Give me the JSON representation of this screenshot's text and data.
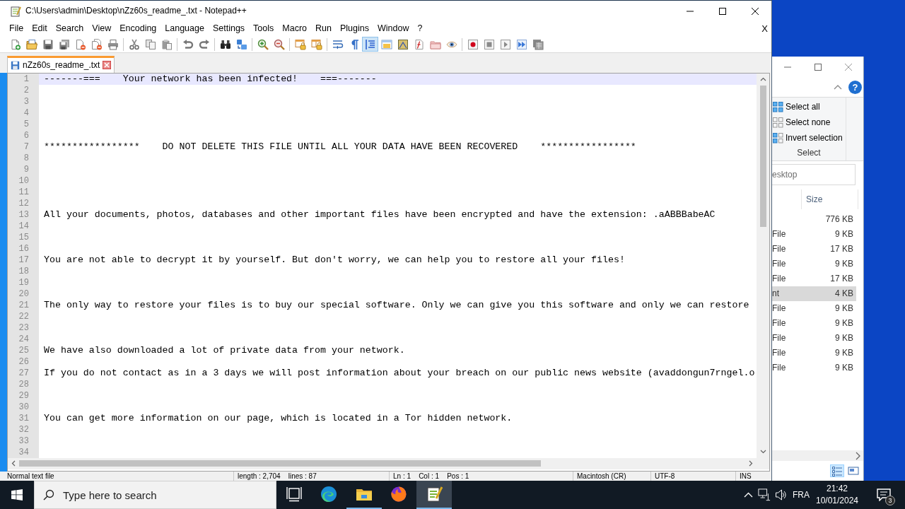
{
  "notepad": {
    "title": "C:\\Users\\admin\\Desktop\\nZz60s_readme_.txt - Notepad++",
    "menu": [
      "File",
      "Edit",
      "Search",
      "View",
      "Encoding",
      "Language",
      "Settings",
      "Tools",
      "Macro",
      "Run",
      "Plugins",
      "Window",
      "?"
    ],
    "close_document": "X",
    "toolbar": [
      {
        "kind": "new",
        "pressed": false
      },
      {
        "kind": "open",
        "pressed": false
      },
      {
        "kind": "save",
        "pressed": false
      },
      {
        "kind": "saveall",
        "pressed": false
      },
      {
        "kind": "close",
        "pressed": false
      },
      {
        "kind": "closeall",
        "pressed": false
      },
      {
        "kind": "print",
        "pressed": false
      },
      {
        "kind": "separator"
      },
      {
        "kind": "cut",
        "pressed": false
      },
      {
        "kind": "copy",
        "pressed": false
      },
      {
        "kind": "paste",
        "pressed": false
      },
      {
        "kind": "separator"
      },
      {
        "kind": "undo",
        "pressed": false
      },
      {
        "kind": "redo",
        "pressed": false
      },
      {
        "kind": "separator"
      },
      {
        "kind": "find",
        "pressed": false
      },
      {
        "kind": "replace",
        "pressed": false
      },
      {
        "kind": "separator"
      },
      {
        "kind": "zoomin",
        "pressed": false
      },
      {
        "kind": "zoomout",
        "pressed": false
      },
      {
        "kind": "separator"
      },
      {
        "kind": "syncv",
        "pressed": false
      },
      {
        "kind": "synch",
        "pressed": false
      },
      {
        "kind": "separator"
      },
      {
        "kind": "wrap",
        "pressed": false
      },
      {
        "kind": "allchars",
        "pressed": false
      },
      {
        "kind": "indent",
        "pressed": true
      },
      {
        "kind": "udl",
        "pressed": false
      },
      {
        "kind": "docmap",
        "pressed": false
      },
      {
        "kind": "funclist",
        "pressed": false
      },
      {
        "kind": "folder",
        "pressed": false
      },
      {
        "kind": "monitor",
        "pressed": false
      },
      {
        "kind": "separator"
      },
      {
        "kind": "record",
        "pressed": false
      },
      {
        "kind": "stop",
        "pressed": false
      },
      {
        "kind": "play",
        "pressed": false
      },
      {
        "kind": "playmulti",
        "pressed": false
      },
      {
        "kind": "savemacro",
        "pressed": false
      }
    ],
    "tabs": [
      {
        "label": "nZz60s_readme_.txt",
        "selected": true
      }
    ],
    "lines": [
      {
        "number": "1",
        "text": "-------===    Your network has been infected!    ===-------",
        "current": true
      },
      {
        "number": "2",
        "current": false
      },
      {
        "number": "3",
        "current": false
      },
      {
        "number": "4",
        "current": false
      },
      {
        "number": "5",
        "current": false
      },
      {
        "number": "6",
        "current": false
      },
      {
        "number": "7",
        "text": "*****************    DO NOT DELETE THIS FILE UNTIL ALL YOUR DATA HAVE BEEN RECOVERED    *****************",
        "current": false
      },
      {
        "number": "8",
        "current": false
      },
      {
        "number": "9",
        "current": false
      },
      {
        "number": "10",
        "current": false
      },
      {
        "number": "11",
        "current": false
      },
      {
        "number": "12",
        "current": false
      },
      {
        "number": "13",
        "text": "All your documents, photos, databases and other important files have been encrypted and have the extension: .aABBBabeAC",
        "current": false
      },
      {
        "number": "14",
        "current": false
      },
      {
        "number": "15",
        "current": false
      },
      {
        "number": "16",
        "current": false
      },
      {
        "number": "17",
        "text": "You are not able to decrypt it by yourself. But don't worry, we can help you to restore all your files!",
        "current": false
      },
      {
        "number": "18",
        "current": false
      },
      {
        "number": "19",
        "current": false
      },
      {
        "number": "20",
        "current": false
      },
      {
        "number": "21",
        "text": "The only way to restore your files is to buy our special software. Only we can give you this software and only we can restore",
        "current": false
      },
      {
        "number": "22",
        "current": false
      },
      {
        "number": "23",
        "current": false
      },
      {
        "number": "24",
        "current": false
      },
      {
        "number": "25",
        "text": "We have also downloaded a lot of private data from your network.",
        "current": false
      },
      {
        "number": "26",
        "current": false
      },
      {
        "number": "27",
        "text": "If you do not contact as in a 3 days we will post information about your breach on our public news website (avaddongun7rngel.o",
        "current": false
      },
      {
        "number": "28",
        "current": false
      },
      {
        "number": "29",
        "current": false
      },
      {
        "number": "30",
        "current": false
      },
      {
        "number": "31",
        "text": "You can get more information on our page, which is located in a Tor hidden network.",
        "current": false
      },
      {
        "number": "32",
        "current": false
      },
      {
        "number": "33",
        "current": false
      },
      {
        "number": "34",
        "current": false
      }
    ],
    "status_bar": [
      "Normal text file",
      "length : 2,704    lines : 87",
      "Ln : 1    Col : 1    Pos : 1",
      "Macintosh (CR)",
      "UTF-8",
      "INS"
    ]
  },
  "explorer": {
    "help": "?",
    "select_actions": [
      {
        "kind": "all",
        "label": "Select all"
      },
      {
        "kind": "none",
        "label": "Select none"
      },
      {
        "kind": "invert",
        "label": "Invert selection"
      }
    ],
    "group_label": "Select",
    "search": {
      "placeholder": "esktop"
    },
    "columns": [
      "Size"
    ],
    "rows": [
      {
        "size": "776 KB",
        "selected": false
      },
      {
        "type": "File",
        "size": "9 KB",
        "selected": false
      },
      {
        "type": "File",
        "size": "17 KB",
        "selected": false
      },
      {
        "type": "File",
        "size": "9 KB",
        "selected": false
      },
      {
        "type": "File",
        "size": "17 KB",
        "selected": false
      },
      {
        "type": "nt",
        "size": "4 KB",
        "selected": true
      },
      {
        "type": "File",
        "size": "9 KB",
        "selected": false
      },
      {
        "type": "File",
        "size": "9 KB",
        "selected": false
      },
      {
        "type": "File",
        "size": "9 KB",
        "selected": false
      },
      {
        "type": "File",
        "size": "9 KB",
        "selected": false
      },
      {
        "type": "File",
        "size": "9 KB",
        "selected": false
      }
    ],
    "views": [
      {
        "kind": "details",
        "selected": true
      },
      {
        "kind": "tiles",
        "selected": false
      }
    ]
  },
  "taskbar": {
    "search": {
      "placeholder": "Type here to search"
    },
    "apps": [
      {
        "kind": "taskview",
        "running": false,
        "active": false
      },
      {
        "kind": "browser",
        "running": false,
        "active": false
      },
      {
        "kind": "files",
        "running": true,
        "active": false
      },
      {
        "kind": "globe",
        "running": false,
        "active": false
      },
      {
        "kind": "notepad",
        "running": true,
        "active": true
      }
    ],
    "language": "FRA",
    "time": "21:42",
    "date": "10/01/2024",
    "notifications": "3"
  }
}
